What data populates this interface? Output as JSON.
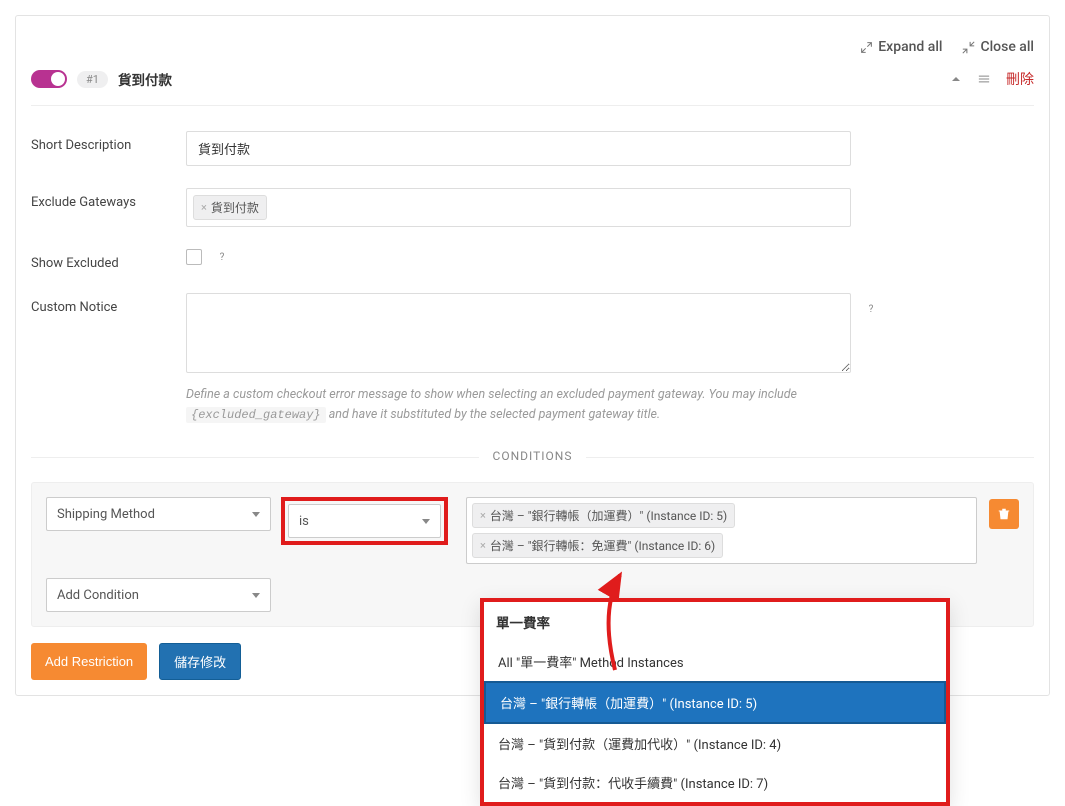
{
  "top": {
    "expand": "Expand all",
    "close": "Close all"
  },
  "header": {
    "id_badge": "#1",
    "title": "貨到付款",
    "delete": "刪除"
  },
  "fields": {
    "short_desc_label": "Short Description",
    "short_desc_value": "貨到付款",
    "exclude_gw_label": "Exclude Gateways",
    "exclude_gw_chips": [
      "貨到付款"
    ],
    "show_excluded_label": "Show Excluded",
    "custom_notice_label": "Custom Notice",
    "custom_notice_help1": "Define a custom checkout error message to show when selecting an excluded payment gateway. You may include ",
    "custom_notice_code": "{excluded_gateway}",
    "custom_notice_help2": " and have it substituted by the selected payment gateway title."
  },
  "conditions": {
    "divider": "CONDITIONS",
    "shipping_method_label": "Shipping Method",
    "is_label": "is",
    "tags": [
      "台灣 – \"銀行轉帳（加運費）\" (Instance ID: 5)",
      "台灣 – \"銀行轉帳：免運費\" (Instance ID: 6)"
    ],
    "add_condition_label": "Add Condition"
  },
  "dropdown": {
    "header": "單一費率",
    "items": [
      "All \"單一費率\" Method Instances",
      "台灣 – \"銀行轉帳（加運費）\" (Instance ID: 5)",
      "台灣 – \"貨到付款（運費加代收）\" (Instance ID: 4)",
      "台灣 – \"貨到付款：代收手續費\" (Instance ID: 7)"
    ],
    "highlight_index": 1
  },
  "buttons": {
    "add_restriction": "Add Restriction",
    "save": "儲存修改"
  }
}
